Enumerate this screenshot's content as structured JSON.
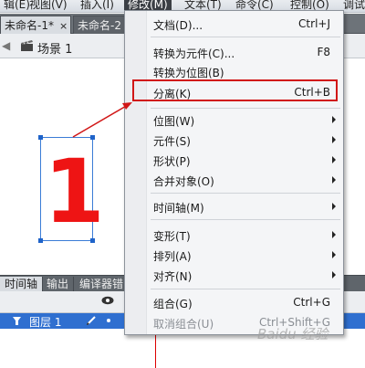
{
  "menubar": {
    "items": [
      {
        "label": "辑(E)"
      },
      {
        "label": "视图(V)"
      },
      {
        "label": "插入(I)"
      },
      {
        "label": "修改(M)",
        "active": true
      },
      {
        "label": "文本(T)"
      },
      {
        "label": "命令(C)"
      },
      {
        "label": "控制(O)"
      },
      {
        "label": "调试"
      }
    ]
  },
  "doc_tabs": [
    {
      "label": "未命名-1*",
      "close": "×",
      "active": true
    },
    {
      "label": "未命名-2",
      "close": "",
      "active": false
    }
  ],
  "scene": {
    "label": "场景 1"
  },
  "stage": {
    "big_text": "1"
  },
  "panel_tabs": [
    "时间轴",
    "输出",
    "编译器错"
  ],
  "timeline": {
    "layer_name": "图层 1"
  },
  "modify_menu": {
    "items": [
      {
        "label": "文档(D)...",
        "shortcut": "Ctrl+J"
      },
      {
        "label": "转换为元件(C)...",
        "shortcut": "F8"
      },
      {
        "label": "转换为位图(B)",
        "shortcut": ""
      },
      {
        "label": "分离(K)",
        "shortcut": "Ctrl+B",
        "highlighted": true
      },
      {
        "label": "位图(W)",
        "submenu": true
      },
      {
        "label": "元件(S)",
        "submenu": true
      },
      {
        "label": "形状(P)",
        "submenu": true
      },
      {
        "label": "合并对象(O)",
        "submenu": true
      },
      {
        "label": "时间轴(M)",
        "submenu": true
      },
      {
        "label": "变形(T)",
        "submenu": true
      },
      {
        "label": "排列(A)",
        "submenu": true
      },
      {
        "label": "对齐(N)",
        "submenu": true
      },
      {
        "label": "组合(G)",
        "shortcut": "Ctrl+G"
      },
      {
        "label": "取消组合(U)",
        "shortcut": "Ctrl+Shift+G",
        "disabled": true
      }
    ]
  },
  "watermark": "Baidu 经验",
  "colors": {
    "highlight_box": "#d11717",
    "big_text": "#ee1414",
    "selection": "#3a7cd6",
    "layer_row": "#2f6fd0"
  }
}
